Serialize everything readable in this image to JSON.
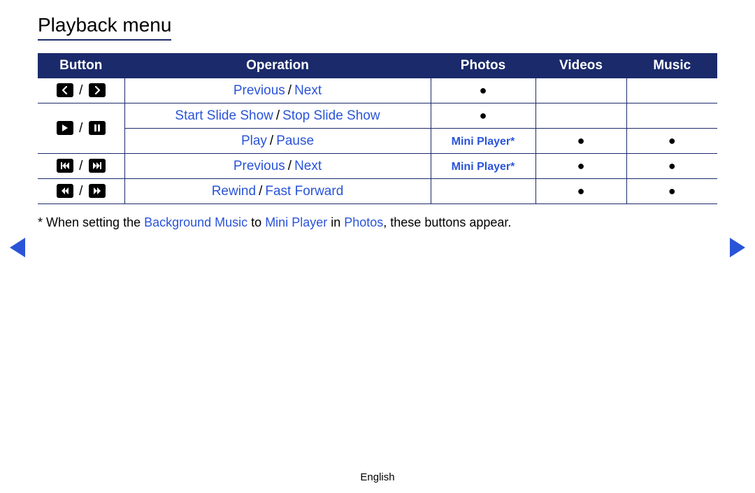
{
  "title": "Playback menu",
  "headers": {
    "button": "Button",
    "operation": "Operation",
    "photos": "Photos",
    "videos": "Videos",
    "music": "Music"
  },
  "rows": {
    "r1": {
      "op_a": "Previous",
      "op_b": "Next",
      "photos": "●",
      "videos": "",
      "music": ""
    },
    "r2": {
      "op_a": "Start Slide Show",
      "op_b": "Stop Slide Show",
      "photos": "●",
      "videos": "",
      "music": ""
    },
    "r3": {
      "op_a": "Play",
      "op_b": "Pause",
      "photos": "Mini Player*",
      "videos": "●",
      "music": "●"
    },
    "r4": {
      "op_a": "Previous",
      "op_b": "Next",
      "photos": "Mini Player*",
      "videos": "●",
      "music": "●"
    },
    "r5": {
      "op_a": "Rewind",
      "op_b": "Fast Forward",
      "photos": "",
      "videos": "●",
      "music": "●"
    }
  },
  "slash": "/",
  "footnote": {
    "prefix": "* When setting the ",
    "bg": "Background Music",
    "to": " to ",
    "mp": "Mini Player",
    "in": " in ",
    "photos": "Photos",
    "suffix": ", these buttons appear."
  },
  "footer": "English"
}
